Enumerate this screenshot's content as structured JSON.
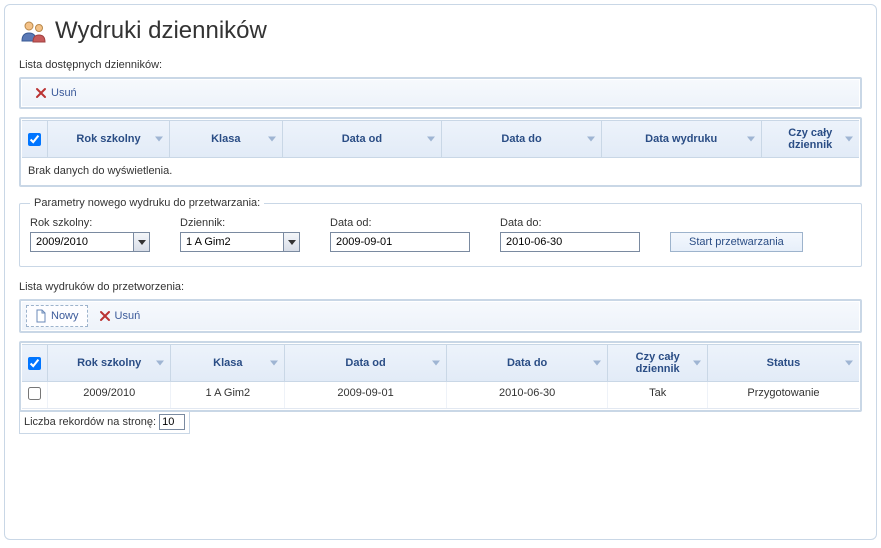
{
  "header": {
    "title": "Wydruki dzienników"
  },
  "section1": {
    "label": "Lista dostępnych dzienników:",
    "toolbar": {
      "delete": "Usuń"
    },
    "columns": {
      "year": "Rok szkolny",
      "class": "Klasa",
      "date_from": "Data od",
      "date_to": "Data do",
      "print_date": "Data wydruku",
      "whole": "Czy cały dziennik"
    },
    "empty": "Brak danych do wyświetlenia."
  },
  "params": {
    "legend": "Parametry nowego wydruku do przetwarzania:",
    "year_label": "Rok szkolny:",
    "year_value": "2009/2010",
    "journal_label": "Dziennik:",
    "journal_value": "1 A Gim2",
    "date_from_label": "Data od:",
    "date_from_value": "2009-09-01",
    "date_to_label": "Data do:",
    "date_to_value": "2010-06-30",
    "start": "Start przetwarzania"
  },
  "section2": {
    "label": "Lista wydruków do przetworzenia:",
    "toolbar": {
      "new": "Nowy",
      "delete": "Usuń"
    },
    "columns": {
      "year": "Rok szkolny",
      "class": "Klasa",
      "date_from": "Data od",
      "date_to": "Data do",
      "whole": "Czy cały dziennik",
      "status": "Status"
    },
    "rows": [
      {
        "year": "2009/2010",
        "class": "1 A Gim2",
        "date_from": "2009-09-01",
        "date_to": "2010-06-30",
        "whole": "Tak",
        "status": "Przygotowanie"
      }
    ],
    "footer": {
      "label": "Liczba rekordów na stronę:",
      "value": "10"
    }
  }
}
